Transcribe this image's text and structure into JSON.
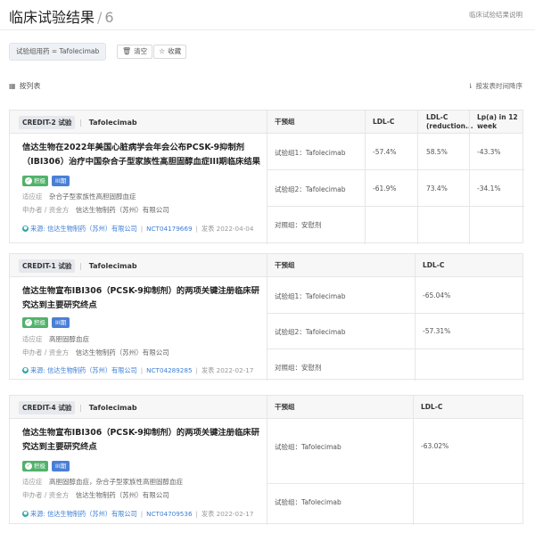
{
  "header": {
    "title": "临床试验结果",
    "separator": "/",
    "count": "6",
    "help_link": "临床试验结果说明"
  },
  "filter": {
    "tag": "试验组用药 = Tafolecimab",
    "clear_label": "清空",
    "save_label": "收藏"
  },
  "list": {
    "title": "按列表",
    "sort_label": "按发表时间降序"
  },
  "cards": [
    {
      "phase": "CREDIT-2 试验",
      "drug": "Tafolecimab",
      "columns": [
        "干预组",
        "LDL-C",
        "LDL-C (reduction...",
        "Lp(a) in 12 week"
      ],
      "title": "信达生物在2022年美国心脏病学会年会公布PCSK-9抑制剂（IBI306）治疗中国杂合子型家族性高胆固醇血症III期临床结果",
      "status": "积极",
      "stage": "III期",
      "indication_label": "适应症",
      "indication": "杂合子型家族性高胆固醇血症",
      "sponsor_label": "申办者 / 资金方",
      "sponsor": "信达生物制药（苏州）有限公司",
      "source_label": "来源:",
      "source": "信达生物制药（苏州）有限公司",
      "nct": "NCT04179669",
      "published_label": "发表",
      "date": "2022-04-04",
      "rows": [
        {
          "group": "试验组1：Tafolecimab",
          "values": [
            "-57.4%",
            "58.5%",
            "-43.3%"
          ]
        },
        {
          "group": "试验组2：Tafolecimab",
          "values": [
            "-61.9%",
            "73.4%",
            "-34.1%"
          ]
        },
        {
          "group": "对照组：安慰剂",
          "values": [
            "",
            "",
            ""
          ]
        }
      ]
    },
    {
      "phase": "CREDIT-1 试验",
      "drug": "Tafolecimab",
      "columns": [
        "干预组",
        "LDL-C"
      ],
      "title": "信达生物宣布IBI306（PCSK-9抑制剂）的两项关键注册临床研究达到主要研究终点",
      "status": "积极",
      "stage": "III期",
      "indication_label": "适应症",
      "indication": "高胆固醇血症",
      "sponsor_label": "申办者 / 资金方",
      "sponsor": "信达生物制药（苏州）有限公司",
      "source_label": "来源:",
      "source": "信达生物制药（苏州）有限公司",
      "nct": "NCT04289285",
      "published_label": "发表",
      "date": "2022-02-17",
      "rows": [
        {
          "group": "试验组1：Tafolecimab",
          "values": [
            "-65.04%"
          ]
        },
        {
          "group": "试验组2：Tafolecimab",
          "values": [
            "-57.31%"
          ]
        },
        {
          "group": "对照组：安慰剂",
          "values": [
            ""
          ]
        }
      ]
    },
    {
      "phase": "CREDIT-4 试验",
      "drug": "Tafolecimab",
      "columns": [
        "干预组",
        "LDL-C"
      ],
      "title": "信达生物宣布IBI306（PCSK-9抑制剂）的两项关键注册临床研究达到主要研究终点",
      "status": "积极",
      "stage": "III期",
      "indication_label": "适应症",
      "indication": "高胆固醇血症，杂合子型家族性高胆固醇血症",
      "sponsor_label": "申办者 / 资金方",
      "sponsor": "信达生物制药（苏州）有限公司",
      "source_label": "来源:",
      "source": "信达生物制药（苏州）有限公司",
      "nct": "NCT04709536",
      "published_label": "发表",
      "date": "2022-02-17",
      "rows": [
        {
          "group": "试验组：Tafolecimab",
          "values": [
            "-63.02%"
          ]
        },
        {
          "group": "试验组：Tafolecimab",
          "values": [
            ""
          ]
        }
      ]
    }
  ]
}
